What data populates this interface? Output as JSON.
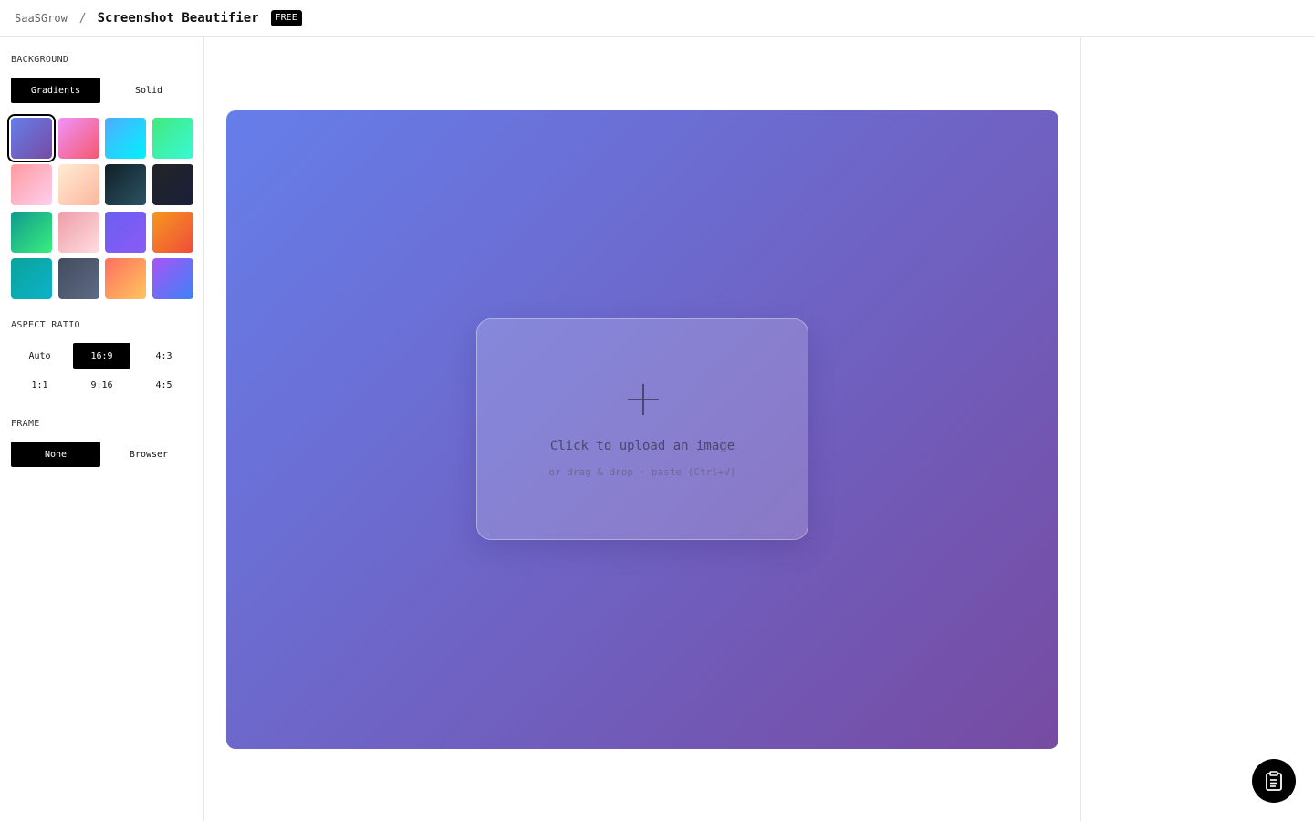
{
  "header": {
    "parent": "SaaSGrow",
    "separator": "/",
    "title": "Screenshot Beautifier",
    "badge": "FREE"
  },
  "sidebar": {
    "background": {
      "label": "BACKGROUND",
      "tabs": [
        {
          "label": "Gradients",
          "active": true
        },
        {
          "label": "Solid",
          "active": false
        }
      ],
      "swatches": [
        {
          "name": "violet-blue",
          "from": "#667eea",
          "to": "#764ba2",
          "selected": true
        },
        {
          "name": "pink-rose",
          "from": "#f093fb",
          "to": "#f5576c",
          "selected": false
        },
        {
          "name": "sky-cyan",
          "from": "#4facfe",
          "to": "#00f2fe",
          "selected": false
        },
        {
          "name": "mint",
          "from": "#43e97b",
          "to": "#38f9d7",
          "selected": false
        },
        {
          "name": "soft-pink",
          "from": "#ff9a9e",
          "to": "#fecfef",
          "selected": false
        },
        {
          "name": "peach",
          "from": "#ffecd2",
          "to": "#fcb69f",
          "selected": false
        },
        {
          "name": "dark-teal",
          "from": "#0f2027",
          "to": "#2c5364",
          "selected": false
        },
        {
          "name": "midnight",
          "from": "#232526",
          "to": "#1a1f3a",
          "selected": false
        },
        {
          "name": "emerald",
          "from": "#11998e",
          "to": "#38ef7d",
          "selected": false
        },
        {
          "name": "blush",
          "from": "#ee9ca7",
          "to": "#ffdde1",
          "selected": false
        },
        {
          "name": "indigo",
          "from": "#6a5ef0",
          "to": "#8b5cf6",
          "selected": false
        },
        {
          "name": "orange-fire",
          "from": "#f7971e",
          "to": "#ee4d3b",
          "selected": false
        },
        {
          "name": "teal",
          "from": "#0ba29b",
          "to": "#0cb3c9",
          "selected": false
        },
        {
          "name": "slate",
          "from": "#434c5e",
          "to": "#5d6b85",
          "selected": false
        },
        {
          "name": "coral-sunrise",
          "from": "#ff6f61",
          "to": "#ffc55c",
          "selected": false
        },
        {
          "name": "purple-blue",
          "from": "#a855f7",
          "to": "#3b82f6",
          "selected": false
        }
      ]
    },
    "aspect": {
      "label": "ASPECT RATIO",
      "options": [
        {
          "label": "Auto",
          "active": false
        },
        {
          "label": "16:9",
          "active": true
        },
        {
          "label": "4:3",
          "active": false
        },
        {
          "label": "1:1",
          "active": false
        },
        {
          "label": "9:16",
          "active": false
        },
        {
          "label": "4:5",
          "active": false
        }
      ]
    },
    "frame": {
      "label": "FRAME",
      "options": [
        {
          "label": "None",
          "active": true
        },
        {
          "label": "Browser",
          "active": false
        }
      ]
    }
  },
  "canvas": {
    "gradient_from": "#667eea",
    "gradient_to": "#764ba2",
    "upload": {
      "icon": "plus-icon",
      "title": "Click to upload an image",
      "subtitle": "or drag & drop · paste (Ctrl+V)"
    }
  },
  "fab": {
    "icon": "clipboard-icon"
  }
}
